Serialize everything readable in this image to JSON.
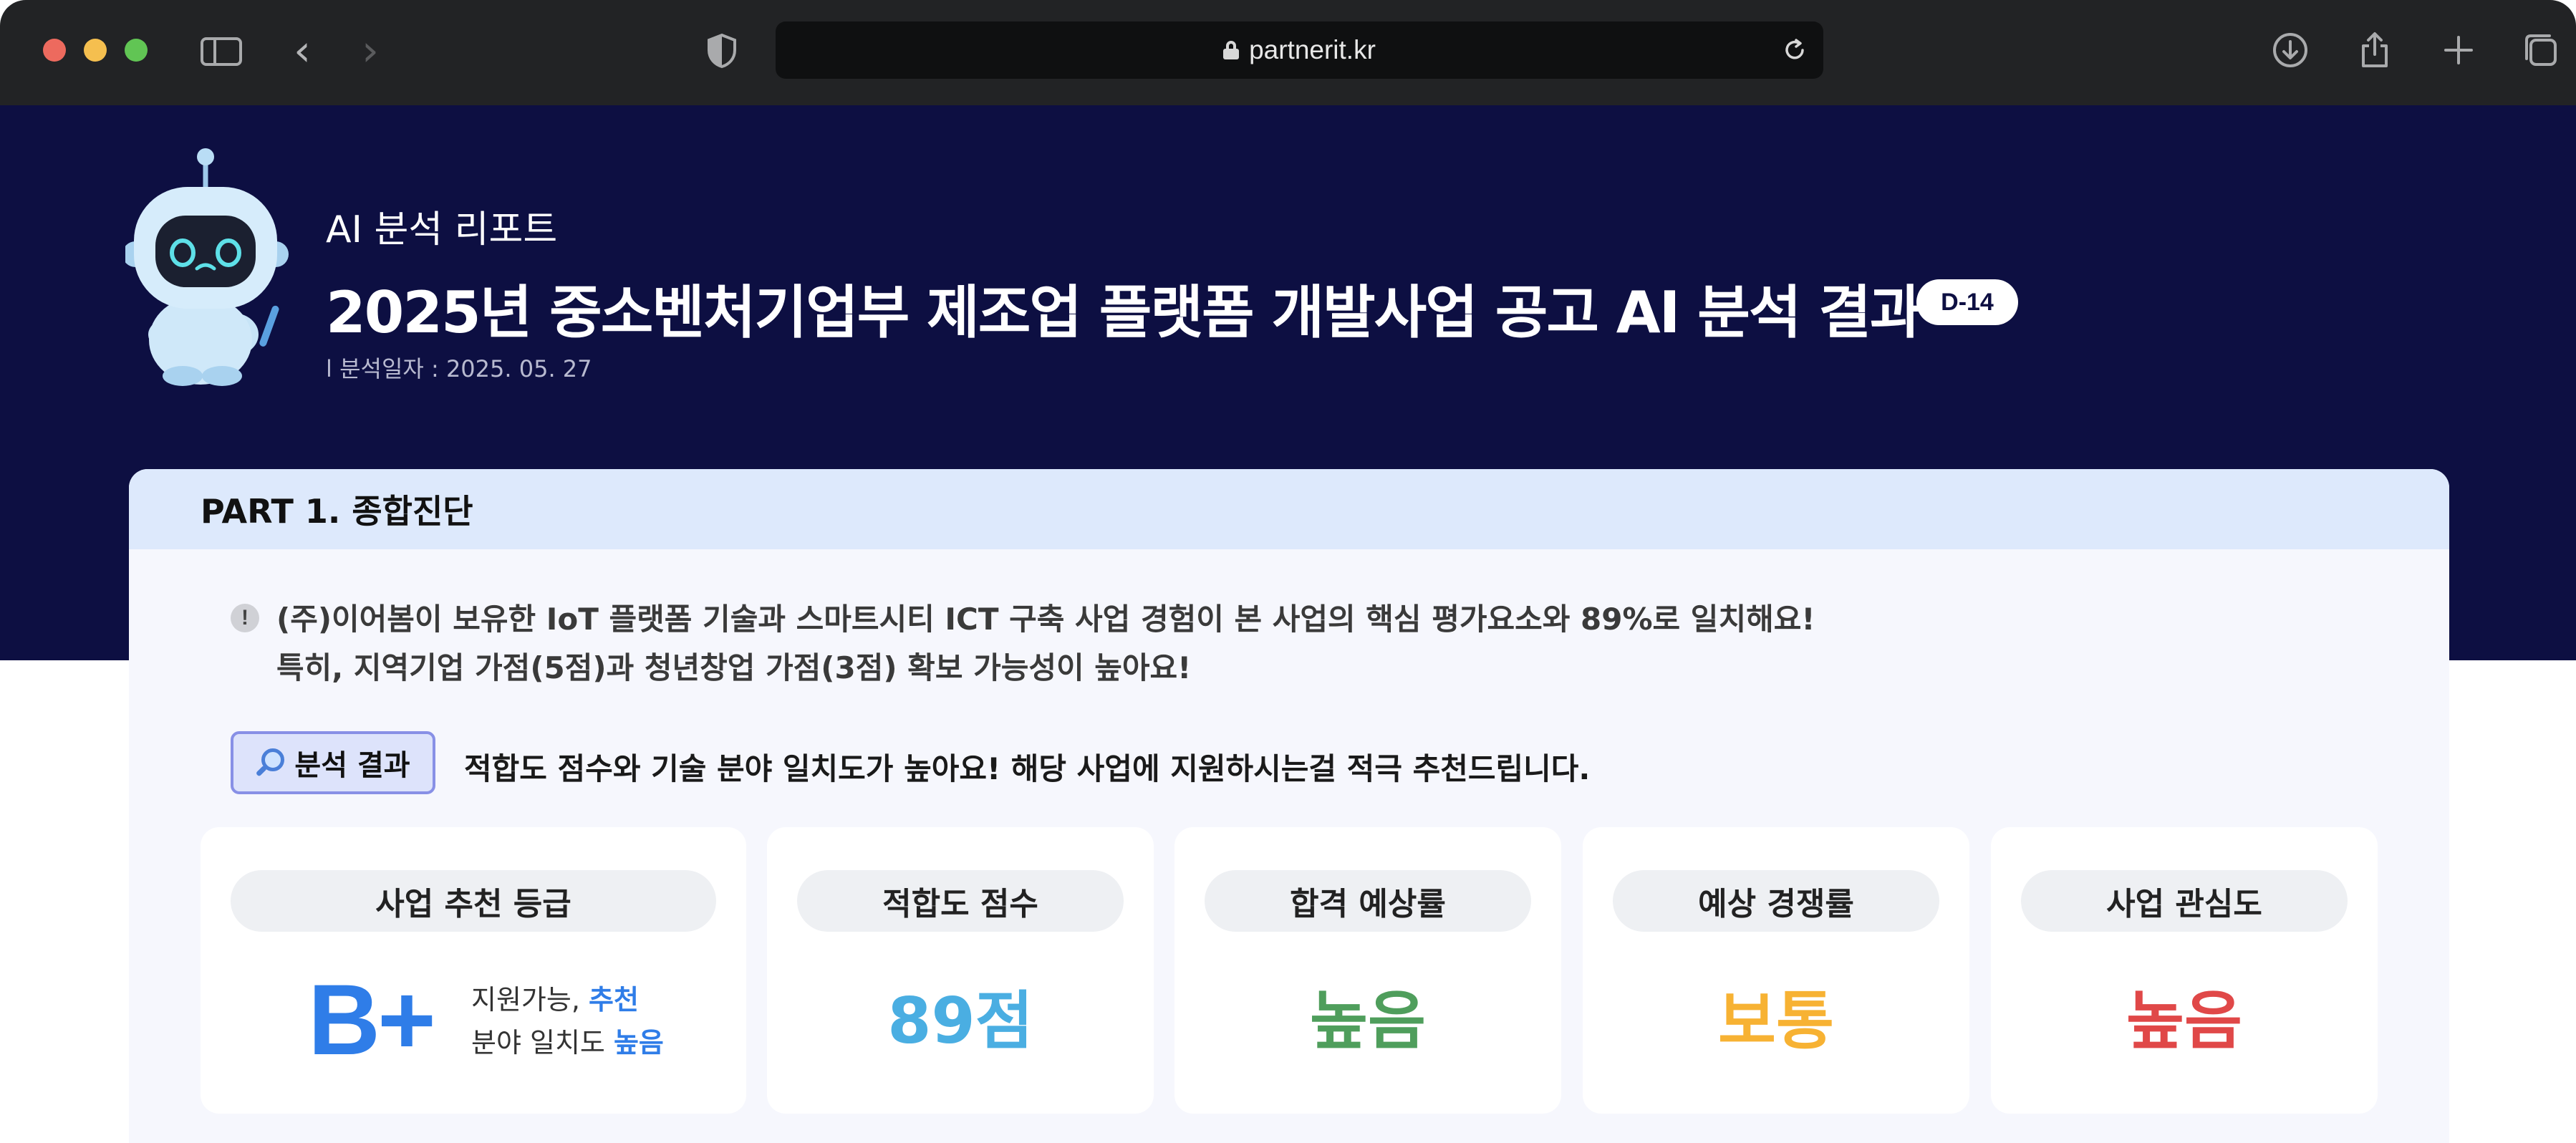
{
  "browser": {
    "url": "partnerit.kr"
  },
  "header": {
    "subtitle": "AI 분석 리포트",
    "title": "2025년 중소벤처기업부 제조업 플랫폼 개발사업 공고 AI 분석 결과",
    "dday_badge": "D-14",
    "analysis_date": "l 분석일자 : 2025. 05. 27"
  },
  "part1": {
    "title": "PART 1.  종합진단",
    "notice_lines": [
      "(주)이어봄이 보유한 IoT 플랫폼 기술과 스마트시티 ICT 구축 사업 경험이 본 사업의 핵심 평가요소와 89%로 일치해요!",
      "특히, 지역기업 가점(5점)과 청년창업 가점(3점) 확보 가능성이 높아요!"
    ],
    "notice_icon": "!",
    "result_chip_label": "분석 결과",
    "result_text": "적합도 점수와 기술 분야 일치도가 높아요! 해당 사업에 지원하시는걸 적극 추천드립니다.",
    "metrics": {
      "grade": {
        "label": "사업 추천 등급",
        "value": "B+",
        "note1_prefix": "지원가능, ",
        "note1_highlight": "추천",
        "note2_prefix": "분야 일치도 ",
        "note2_highlight": "높음"
      },
      "fit_score": {
        "label": "적합도 점수",
        "value": "89점",
        "color": "#4aaee2"
      },
      "pass_rate": {
        "label": "합격 예상률",
        "value": "높음",
        "color": "#4f9e5c"
      },
      "competition": {
        "label": "예상 경쟁률",
        "value": "보통",
        "color": "#f7b233"
      },
      "interest": {
        "label": "사업 관심도",
        "value": "높음",
        "color": "#e04848"
      }
    }
  },
  "colors": {
    "hero_bg": "#0d0f42",
    "card_header_bg": "#dde9fc",
    "accent_blue": "#2f7de8"
  }
}
